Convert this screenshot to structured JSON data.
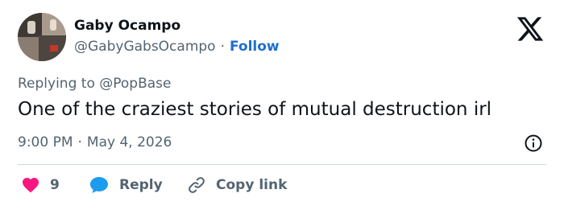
{
  "author": {
    "name": "Gaby Ocampo",
    "handle": "@GabyGabsOcampo",
    "separator": "·",
    "follow_label": "Follow"
  },
  "tweet": {
    "reply_prefix": "Replying to",
    "reply_to": "@PopBase",
    "text": "One of the craziest stories of mutual destruction irl",
    "time": "9:00 PM",
    "separator": "·",
    "date": "May 4, 2026"
  },
  "actions": {
    "like_count": "9",
    "reply_label": "Reply",
    "copy_label": "Copy link"
  },
  "icons": {
    "logo": "x-logo-icon",
    "info": "info-icon",
    "like": "heart-icon",
    "reply": "speech-bubble-icon",
    "copy": "link-icon"
  },
  "colors": {
    "accent": "#1d9bf0",
    "follow": "#1d6fcf",
    "like": "#f91880",
    "text": "#0f1419",
    "muted": "#536471"
  }
}
